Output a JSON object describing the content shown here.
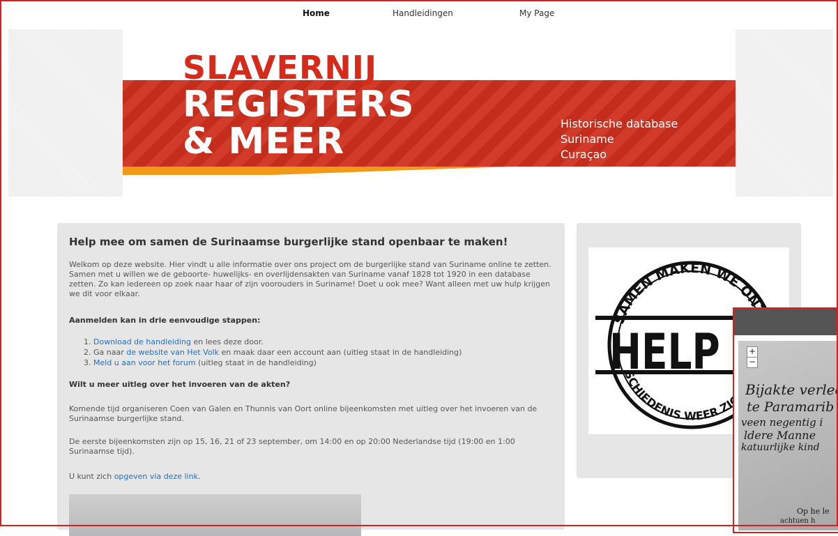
{
  "nav": {
    "items": [
      "Home",
      "Handleidingen",
      "My Page"
    ]
  },
  "banner": {
    "title_line1": "SLAVERNIJ",
    "title_line2": "REGISTERS",
    "title_line3": "& MEER",
    "subtitle_line1": "Historische database",
    "subtitle_line2": "Suriname",
    "subtitle_line3": "Curaçao"
  },
  "main": {
    "heading": "Help mee om samen de Surinaamse burgerlijke stand openbaar te maken!",
    "intro": "Welkom op deze website. Hier vindt u alle informatie over ons project om de burgerlijke stand van Suriname online te zetten. Samen met u willen we de geboorte- huwelijks- en overlijdensakten van Suriname vanaf 1828 tot 1920 in een database zetten. Zo kan iedereen op zoek naar haar of zijn voorouders in Suriname! Doet u ook mee? Want alleen met uw hulp krijgen we dit voor elkaar.",
    "steps_heading": "Aanmelden kan in drie eenvoudige stappen:",
    "step1_num": "1.",
    "step1_link": "Download de handleiding",
    "step1_rest": " en lees deze door.",
    "step2_num": "2.",
    "step2_pre": "Ga naar ",
    "step2_link": "de website van Het Volk",
    "step2_rest": " en maak daar een account aan (uitleg staat in de handleiding)",
    "step3_num": "3.",
    "step3_link": "Meld u aan voor het forum",
    "step3_rest": " (uitleg staat in de handleiding)",
    "question_heading": "Wilt u meer uitleg over het invoeren van de akten?",
    "para1": "Komende tijd organiseren Coen van Galen en Thunnis van Oort online bijeenkomsten met uitleg over het invoeren van de Surinaamse burgerlijke stand.",
    "para2": "De eerste bijeenkomsten zijn op 15, 16, 21 of 23 september, om 14:00 en op 20:00 Nederlandse tijd (19:00 en 1:00 Surinaamse tijd).",
    "signup_pre": "U kunt zich ",
    "signup_link": "opgeven via deze link",
    "signup_post": "."
  },
  "sidebar": {
    "stamp_top": "SAMEN MAKEN WE ONZE",
    "stamp_center": "HELP ME",
    "stamp_bottom": "GESCHIEDENIS WEER ZICHTBAAR"
  },
  "popup": {
    "zoom_in": "+",
    "zoom_out": "−",
    "hw_line1": "Bijakte verlee",
    "hw_line2": "te Paramarib",
    "hw_line3": "veen negentig i",
    "hw_line4": "ldere Manne",
    "hw_line5": "katuurlijke kind",
    "hw_line6": "Op he le",
    "hw_line7": "achtuen h"
  },
  "colors": {
    "brand_red": "#cf2e1c",
    "accent_orange": "#f29a18",
    "link_blue": "#1f6fbf"
  }
}
